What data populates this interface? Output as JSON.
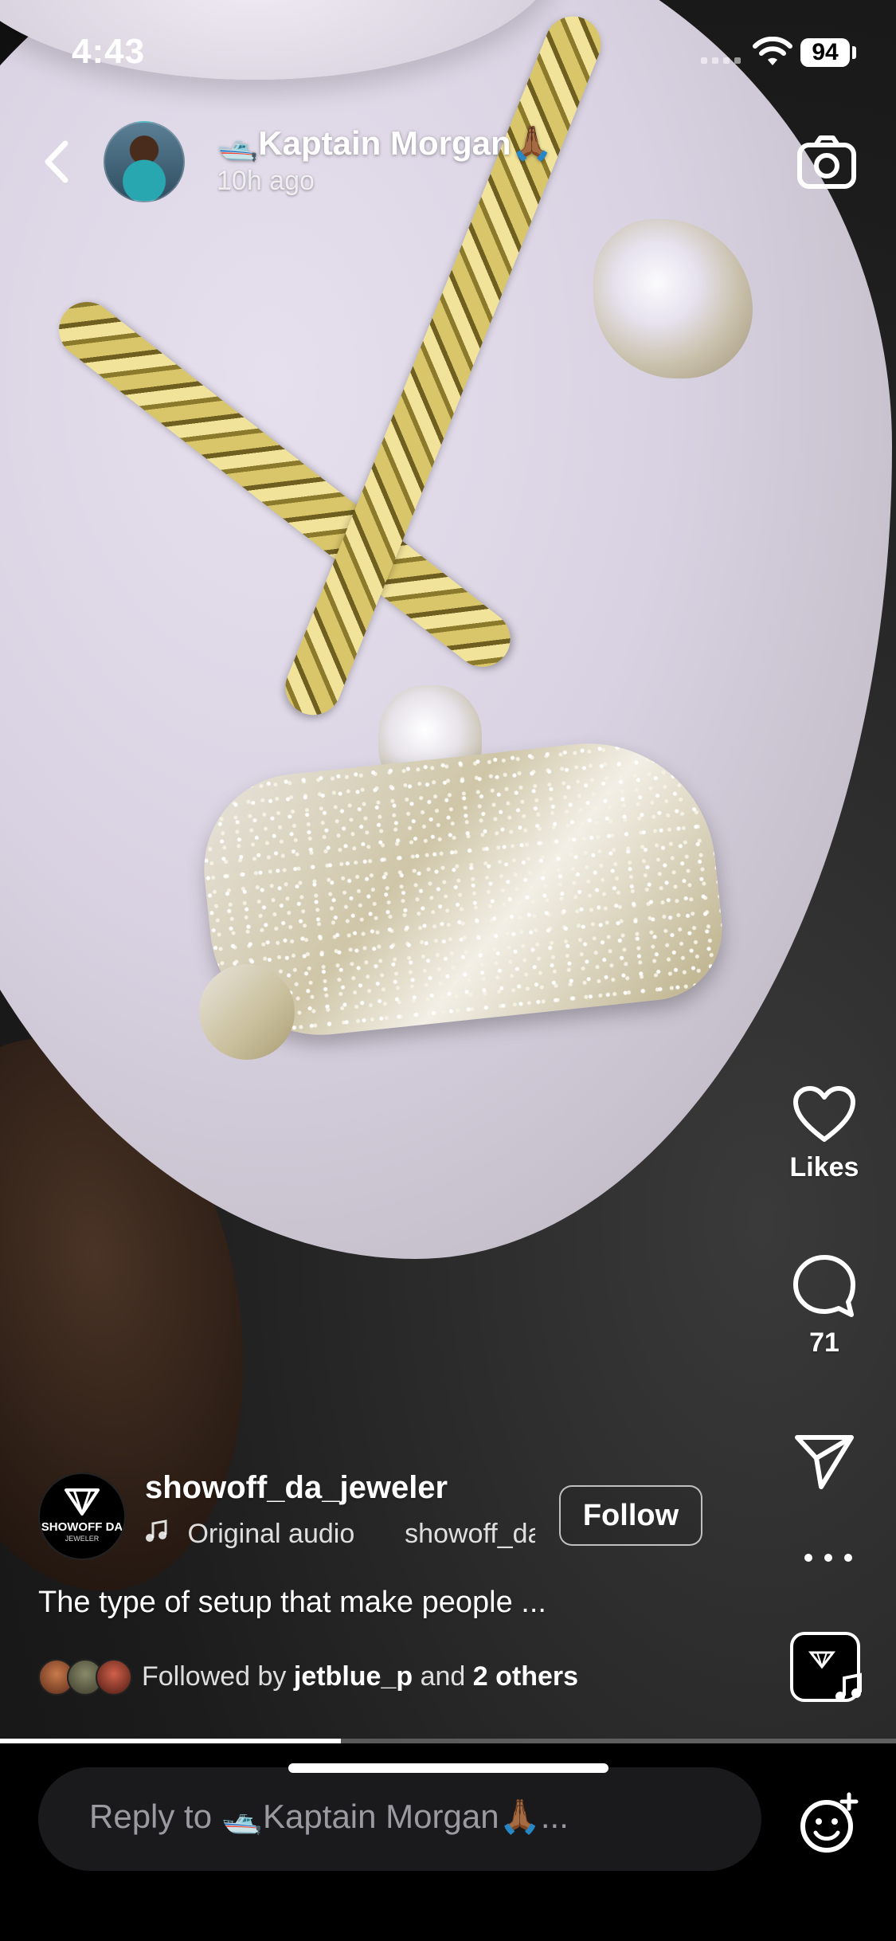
{
  "status_bar": {
    "time": "4:43",
    "battery": "94"
  },
  "story": {
    "user": "🛥️Kaptain Morgan🙏🏾",
    "time_ago": "10h ago",
    "progress": 0.38
  },
  "actions": {
    "like_label": "Likes",
    "comment_count": "71"
  },
  "post": {
    "author": "showoff_da_jeweler",
    "author_logo_text": "SHOWOFF DA",
    "author_logo_sub": "JEWELER",
    "audio_title": "Original audio",
    "audio_author": "showoff_da_jeweler",
    "follow_label": "Follow",
    "caption": "The type of setup that make people ...",
    "followed_prefix": "Followed by",
    "followed_user": "jetblue_p",
    "followed_and": "and",
    "followed_others": "2 others"
  },
  "reply": {
    "placeholder": "Reply to 🛥️Kaptain Morgan🙏🏾..."
  },
  "icons": {
    "back": "chevron-left-icon",
    "camera": "camera-icon",
    "heart": "heart-icon",
    "comment": "comment-bubble-icon",
    "share": "paper-plane-icon",
    "more": "ellipsis-icon",
    "music": "music-note-icon",
    "emoji": "emoji-add-icon"
  }
}
